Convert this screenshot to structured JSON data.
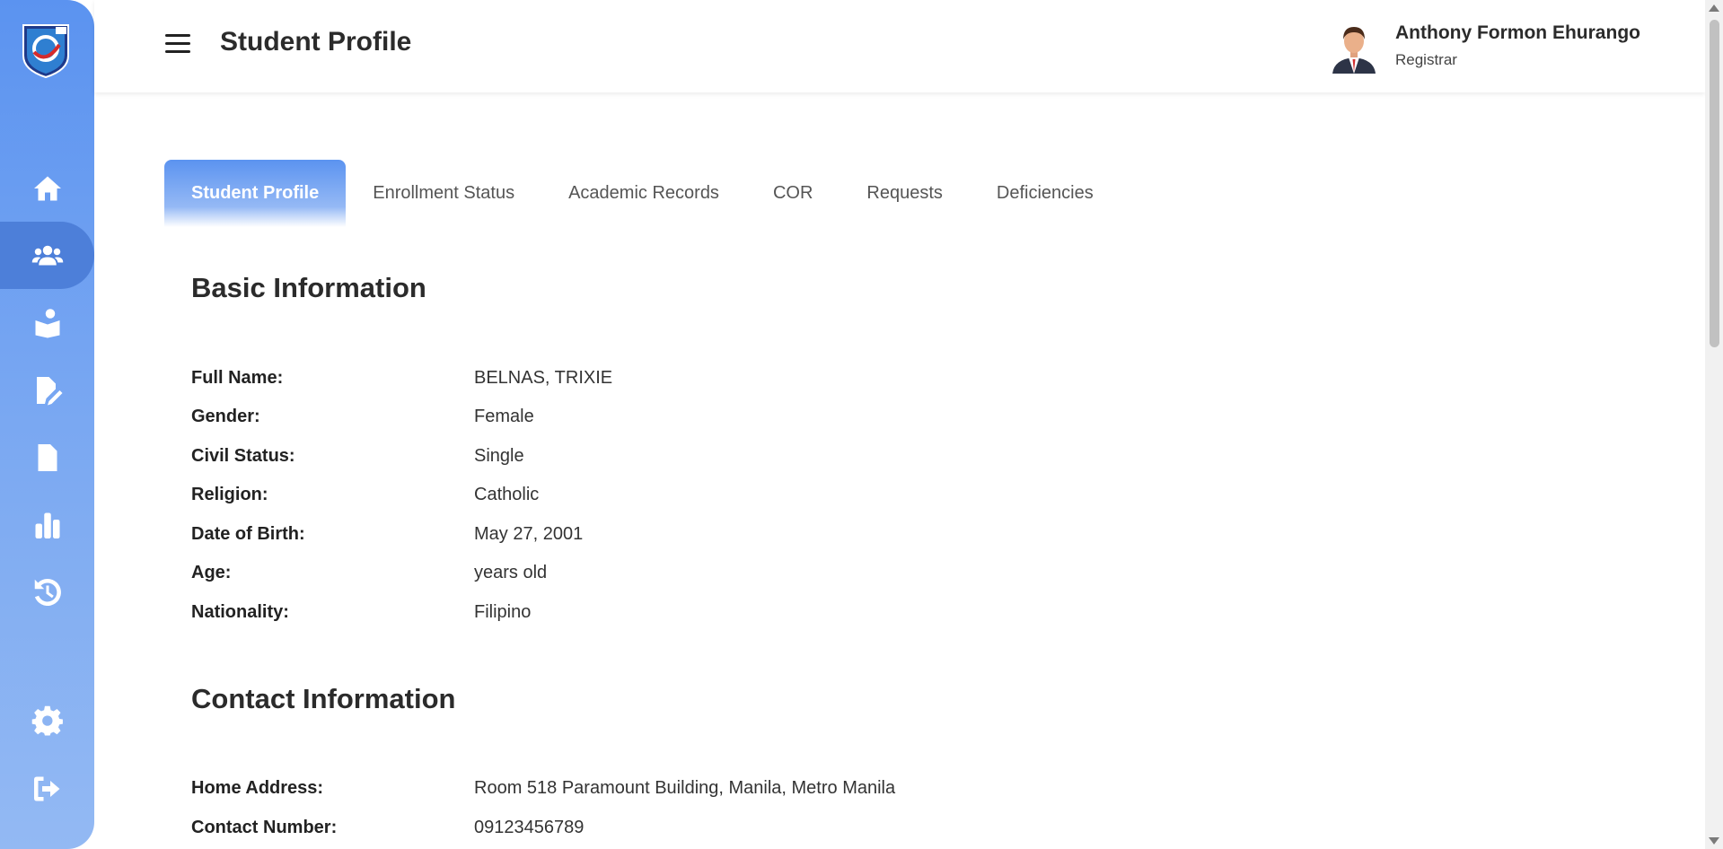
{
  "header": {
    "title": "Student Profile",
    "user_name": "Anthony Formon Ehurango",
    "user_role": "Registrar"
  },
  "sidebar": {
    "items": [
      {
        "icon": "home-icon"
      },
      {
        "icon": "users-icon",
        "active": true
      },
      {
        "icon": "reader-icon"
      },
      {
        "icon": "file-edit-icon"
      },
      {
        "icon": "file-signature-icon"
      },
      {
        "icon": "bar-chart-icon"
      },
      {
        "icon": "history-icon"
      },
      {
        "icon": "gear-icon"
      },
      {
        "icon": "logout-icon"
      }
    ]
  },
  "tabs": [
    {
      "label": "Student Profile",
      "active": true
    },
    {
      "label": "Enrollment Status"
    },
    {
      "label": "Academic Records"
    },
    {
      "label": "COR"
    },
    {
      "label": "Requests"
    },
    {
      "label": "Deficiencies"
    }
  ],
  "basic_info": {
    "title": "Basic Information",
    "fields": [
      {
        "label": "Full Name:",
        "value": "BELNAS, TRIXIE"
      },
      {
        "label": "Gender:",
        "value": "Female"
      },
      {
        "label": "Civil Status:",
        "value": "Single"
      },
      {
        "label": "Religion:",
        "value": "Catholic"
      },
      {
        "label": "Date of Birth:",
        "value": "May 27, 2001"
      },
      {
        "label": "Age:",
        "value": "years old"
      },
      {
        "label": "Nationality:",
        "value": "Filipino"
      }
    ]
  },
  "contact_info": {
    "title": "Contact Information",
    "fields": [
      {
        "label": "Home Address:",
        "value": "Room 518 Paramount Building, Manila, Metro Manila"
      },
      {
        "label": "Contact Number:",
        "value": "09123456789"
      }
    ]
  },
  "colors": {
    "sidebar_top": "#5b93f0",
    "sidebar_bottom": "#93b9f3",
    "active_nav": "#4d7fd9",
    "text_dark": "#2b2b2b"
  }
}
